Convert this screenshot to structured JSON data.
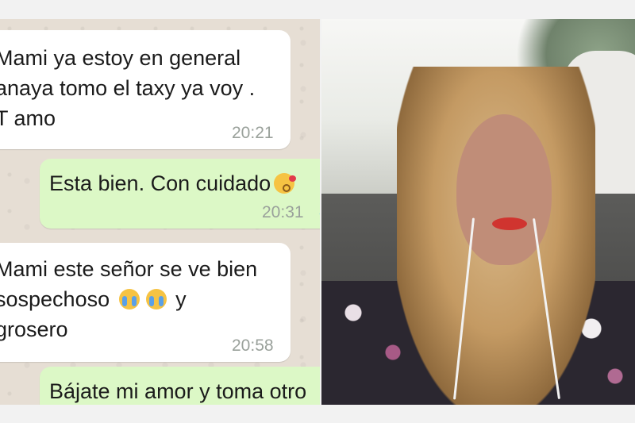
{
  "chat": {
    "messages": [
      {
        "direction": "incoming",
        "text": "Mami ya estoy en general\nanaya tomo el taxy  ya voy .\nT  amo",
        "time": "20:21"
      },
      {
        "direction": "outgoing",
        "text": "Esta bien. Con cuidado",
        "emoji": "kiss",
        "time": "20:31"
      },
      {
        "direction": "incoming",
        "text_line1": "Mami este señor se ve bien",
        "text_line2": "sospechoso",
        "emoji_count": 2,
        "text_after_emoji": "y",
        "text_line3": "grosero",
        "time": "20:58"
      },
      {
        "direction": "outgoing",
        "text": "Bájate mi amor y toma otro"
      }
    ]
  },
  "photo": {
    "subject": "portrait-woman-in-car"
  }
}
